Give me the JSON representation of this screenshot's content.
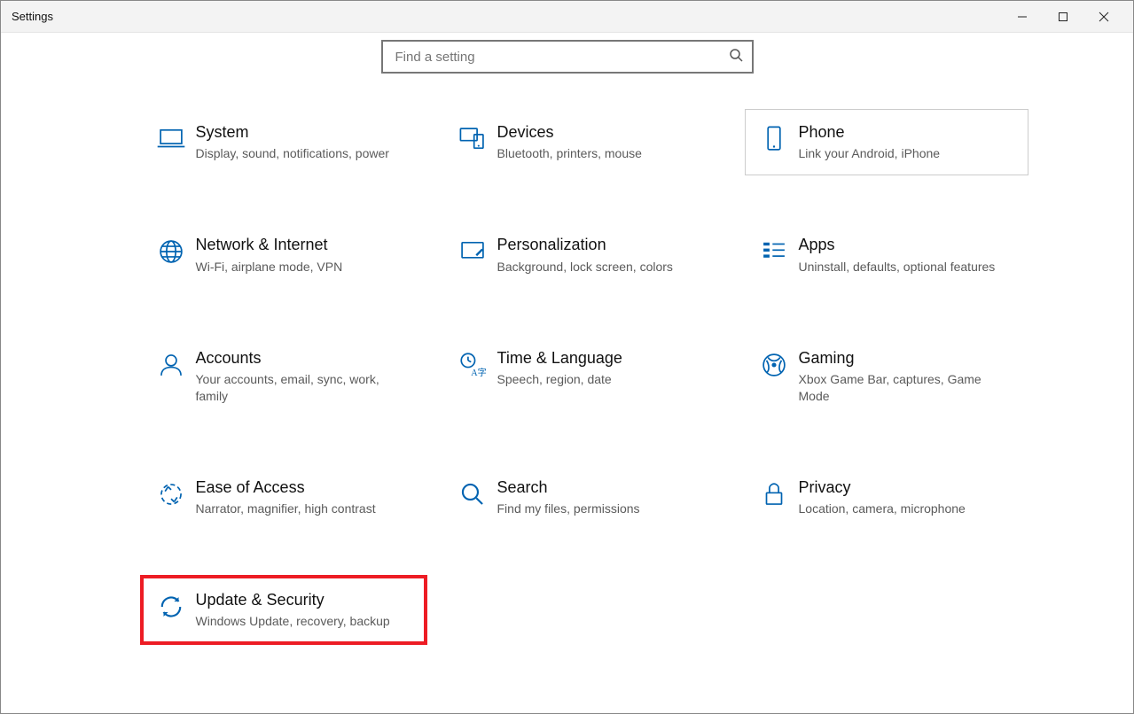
{
  "window": {
    "title": "Settings"
  },
  "search": {
    "placeholder": "Find a setting"
  },
  "cards": [
    {
      "key": "system",
      "title": "System",
      "desc": "Display, sound, notifications, power",
      "icon": "laptop",
      "hovered": false,
      "highlighted": false
    },
    {
      "key": "devices",
      "title": "Devices",
      "desc": "Bluetooth, printers, mouse",
      "icon": "devices",
      "hovered": false,
      "highlighted": false
    },
    {
      "key": "phone",
      "title": "Phone",
      "desc": "Link your Android, iPhone",
      "icon": "phone",
      "hovered": true,
      "highlighted": false
    },
    {
      "key": "network",
      "title": "Network & Internet",
      "desc": "Wi-Fi, airplane mode, VPN",
      "icon": "globe",
      "hovered": false,
      "highlighted": false
    },
    {
      "key": "personal",
      "title": "Personalization",
      "desc": "Background, lock screen, colors",
      "icon": "personal",
      "hovered": false,
      "highlighted": false
    },
    {
      "key": "apps",
      "title": "Apps",
      "desc": "Uninstall, defaults, optional features",
      "icon": "apps",
      "hovered": false,
      "highlighted": false
    },
    {
      "key": "accounts",
      "title": "Accounts",
      "desc": "Your accounts, email, sync, work, family",
      "icon": "account",
      "hovered": false,
      "highlighted": false
    },
    {
      "key": "time",
      "title": "Time & Language",
      "desc": "Speech, region, date",
      "icon": "time",
      "hovered": false,
      "highlighted": false
    },
    {
      "key": "gaming",
      "title": "Gaming",
      "desc": "Xbox Game Bar, captures, Game Mode",
      "icon": "gaming",
      "hovered": false,
      "highlighted": false
    },
    {
      "key": "ease",
      "title": "Ease of Access",
      "desc": "Narrator, magnifier, high contrast",
      "icon": "ease",
      "hovered": false,
      "highlighted": false
    },
    {
      "key": "search",
      "title": "Search",
      "desc": "Find my files, permissions",
      "icon": "magnify",
      "hovered": false,
      "highlighted": false
    },
    {
      "key": "privacy",
      "title": "Privacy",
      "desc": "Location, camera, microphone",
      "icon": "lock",
      "hovered": false,
      "highlighted": false
    },
    {
      "key": "update",
      "title": "Update & Security",
      "desc": "Windows Update, recovery, backup",
      "icon": "update",
      "hovered": false,
      "highlighted": true
    }
  ]
}
